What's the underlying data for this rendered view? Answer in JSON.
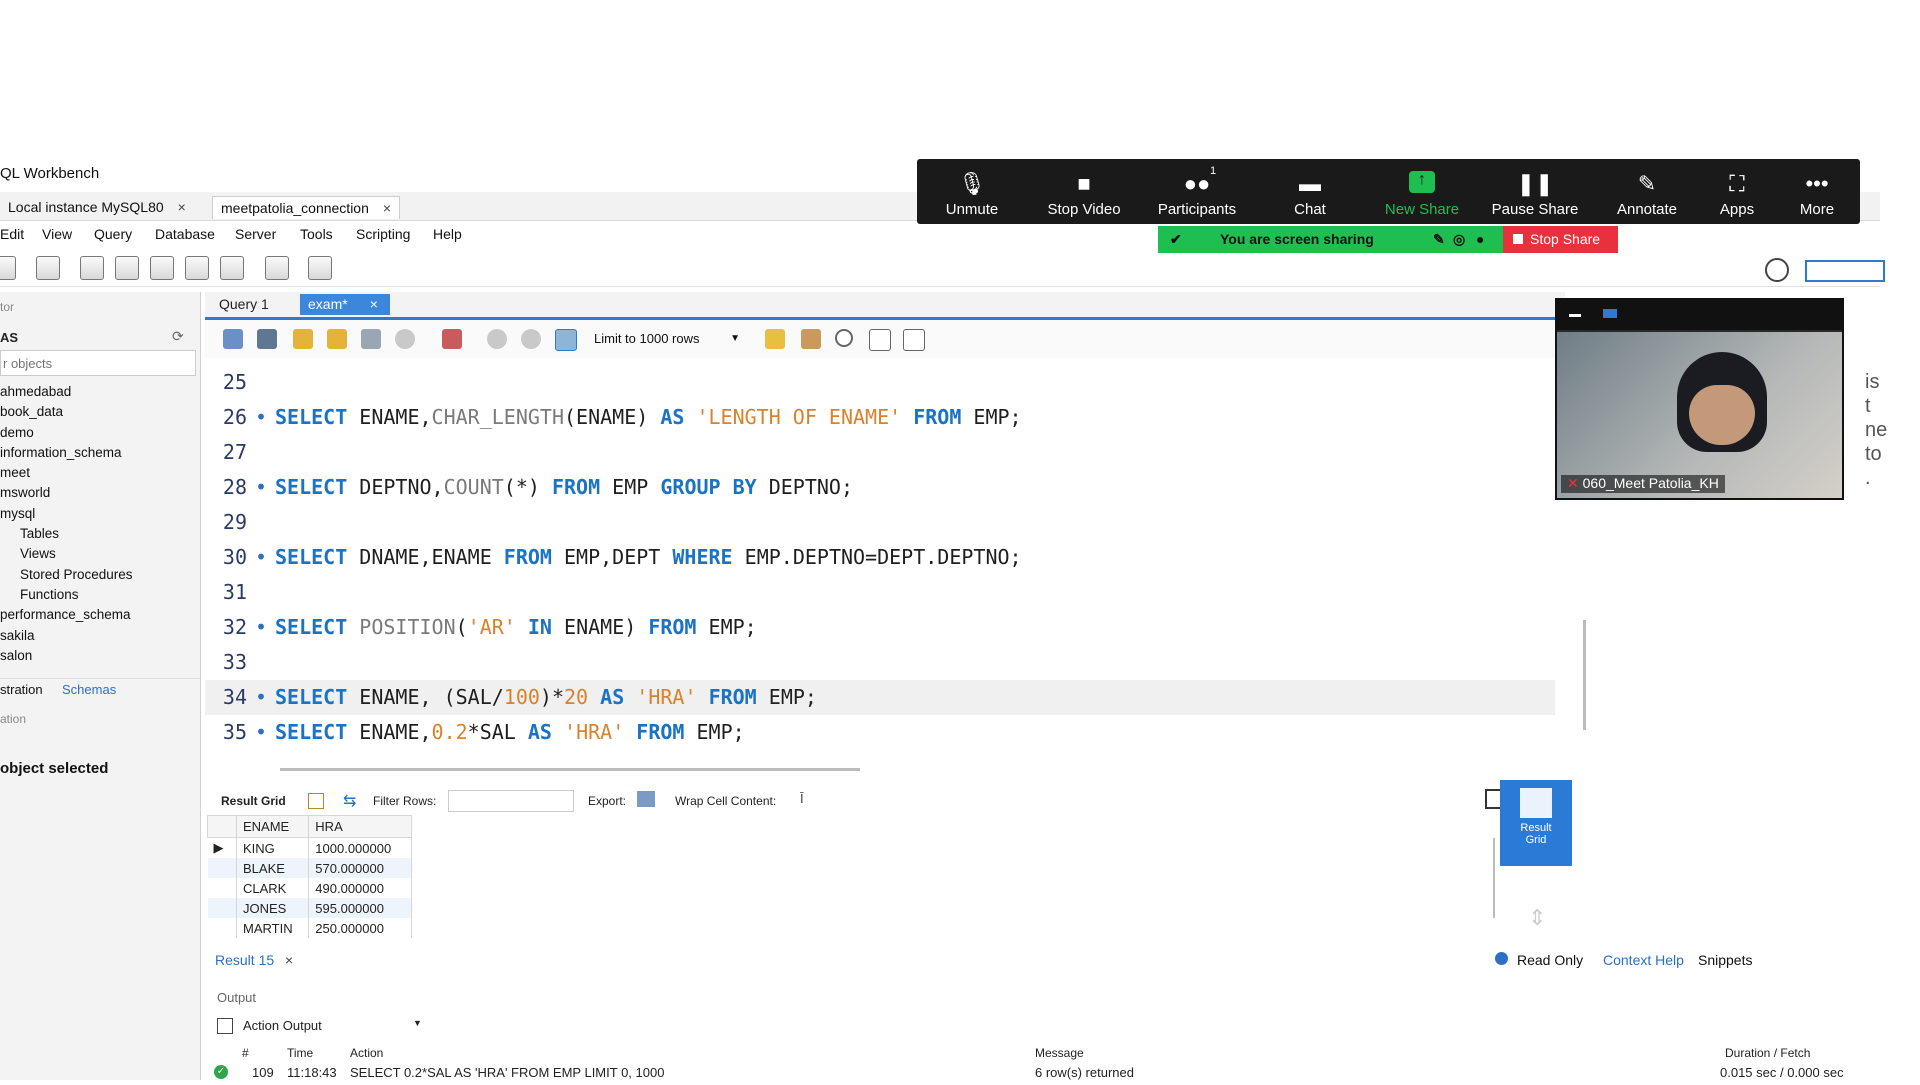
{
  "window": {
    "title": "QL Workbench"
  },
  "conn_tabs": [
    {
      "label": "Local instance MySQL80",
      "close": "×"
    },
    {
      "label": "meetpatolia_connection",
      "close": "×"
    }
  ],
  "menu": [
    "Edit",
    "View",
    "Query",
    "Database",
    "Server",
    "Tools",
    "Scripting",
    "Help"
  ],
  "navigator": {
    "title": "tor",
    "schemas_header": "AS",
    "filter_placeholder": "r objects",
    "schemas": [
      "ahmedabad",
      "book_data",
      "demo",
      "information_schema",
      "meet",
      "msworld",
      "mysql"
    ],
    "mysql_children": [
      "Tables",
      "Views",
      "Stored Procedures",
      "Functions"
    ],
    "more_schemas": [
      "performance_schema",
      "sakila",
      "salon"
    ],
    "tab_admin": "stration",
    "tab_schemas": "Schemas",
    "info_title": "ation",
    "info_text": "object selected"
  },
  "editor_tabs": [
    {
      "label": "Query 1"
    },
    {
      "label": "exam*",
      "close": "×"
    }
  ],
  "editor_toolbar": {
    "limit_label": "Limit to 1000 rows"
  },
  "code_lines": [
    {
      "n": "25",
      "dot": "",
      "tokens": []
    },
    {
      "n": "26",
      "dot": "•",
      "tokens": [
        [
          "kw",
          "SELECT"
        ],
        [
          "code",
          " ENAME,"
        ],
        [
          "fn",
          "CHAR_LENGTH"
        ],
        [
          "code",
          "(ENAME) "
        ],
        [
          "kw",
          "AS"
        ],
        [
          "code",
          " "
        ],
        [
          "str",
          "'LENGTH OF ENAME'"
        ],
        [
          "code",
          " "
        ],
        [
          "kw",
          "FROM"
        ],
        [
          "code",
          " EMP;"
        ]
      ]
    },
    {
      "n": "27",
      "dot": "",
      "tokens": []
    },
    {
      "n": "28",
      "dot": "•",
      "tokens": [
        [
          "kw",
          "SELECT"
        ],
        [
          "code",
          " DEPTNO,"
        ],
        [
          "fn",
          "COUNT"
        ],
        [
          "code",
          "(*) "
        ],
        [
          "kw",
          "FROM"
        ],
        [
          "code",
          " EMP "
        ],
        [
          "kw",
          "GROUP BY"
        ],
        [
          "code",
          " DEPTNO;"
        ]
      ]
    },
    {
      "n": "29",
      "dot": "",
      "tokens": []
    },
    {
      "n": "30",
      "dot": "•",
      "tokens": [
        [
          "kw",
          "SELECT"
        ],
        [
          "code",
          " DNAME,ENAME "
        ],
        [
          "kw",
          "FROM"
        ],
        [
          "code",
          " EMP,DEPT "
        ],
        [
          "kw",
          "WHERE"
        ],
        [
          "code",
          " EMP.DEPTNO=DEPT.DEPTNO;"
        ]
      ]
    },
    {
      "n": "31",
      "dot": "",
      "tokens": []
    },
    {
      "n": "32",
      "dot": "•",
      "tokens": [
        [
          "kw",
          "SELECT"
        ],
        [
          "code",
          " "
        ],
        [
          "fn",
          "POSITION"
        ],
        [
          "code",
          "("
        ],
        [
          "str",
          "'AR'"
        ],
        [
          "code",
          " "
        ],
        [
          "kw",
          "IN"
        ],
        [
          "code",
          " ENAME) "
        ],
        [
          "kw",
          "FROM"
        ],
        [
          "code",
          " EMP;"
        ]
      ]
    },
    {
      "n": "33",
      "dot": "",
      "tokens": []
    },
    {
      "n": "34",
      "dot": "•",
      "hl": true,
      "tokens": [
        [
          "kw",
          "SELECT"
        ],
        [
          "code",
          " ENAME, (SAL/"
        ],
        [
          "num",
          "100"
        ],
        [
          "code",
          ")*"
        ],
        [
          "num",
          "20"
        ],
        [
          "code",
          " "
        ],
        [
          "kw",
          "AS"
        ],
        [
          "code",
          " "
        ],
        [
          "str",
          "'HRA'"
        ],
        [
          "code",
          " "
        ],
        [
          "kw",
          "FROM"
        ],
        [
          "code",
          " EMP;"
        ]
      ]
    },
    {
      "n": "35",
      "dot": "•",
      "tokens": [
        [
          "kw",
          "SELECT"
        ],
        [
          "code",
          " ENAME,"
        ],
        [
          "num",
          "0.2"
        ],
        [
          "code",
          "*SAL "
        ],
        [
          "kw",
          "AS"
        ],
        [
          "code",
          " "
        ],
        [
          "str",
          "'HRA'"
        ],
        [
          "code",
          " "
        ],
        [
          "kw",
          "FROM"
        ],
        [
          "code",
          " EMP;"
        ]
      ]
    }
  ],
  "result_toolbar": {
    "result_grid": "Result Grid",
    "filter_rows": "Filter Rows:",
    "export": "Export:",
    "wrap": "Wrap Cell Content:"
  },
  "result_grid": {
    "columns": [
      "ENAME",
      "HRA"
    ],
    "rows": [
      [
        "KING",
        "1000.000000"
      ],
      [
        "BLAKE",
        "570.000000"
      ],
      [
        "CLARK",
        "490.000000"
      ],
      [
        "JONES",
        "595.000000"
      ],
      [
        "MARTIN",
        "250.000000"
      ]
    ]
  },
  "result_side": {
    "btn_line1": "Result",
    "btn_line2": "Grid",
    "read_only": "Read Only"
  },
  "bottom_tabs": {
    "result": "Result 15",
    "context_help": "Context Help",
    "snippets": "Snippets"
  },
  "output": {
    "title": "Output",
    "mode": "Action Output",
    "headers": [
      "#",
      "Time",
      "Action",
      "Message",
      "Duration / Fetch"
    ],
    "row": {
      "num": "109",
      "time": "11:18:43",
      "action": "SELECT 0.2*SAL AS 'HRA' FROM EMP LIMIT 0, 1000",
      "message": "6 row(s) returned",
      "duration": "0.015 sec / 0.000 sec"
    }
  },
  "zoom": {
    "buttons": [
      {
        "label": "Unmute",
        "icon": "mic-off-icon"
      },
      {
        "label": "Stop Video",
        "icon": "video-icon"
      },
      {
        "label": "Participants",
        "icon": "participants-icon",
        "badge": "1"
      },
      {
        "label": "Chat",
        "icon": "chat-icon"
      },
      {
        "label": "New Share",
        "icon": "share-icon"
      },
      {
        "label": "Pause Share",
        "icon": "pause-icon"
      },
      {
        "label": "Annotate",
        "icon": "pencil-icon"
      },
      {
        "label": "Apps",
        "icon": "apps-icon"
      },
      {
        "label": "More",
        "icon": "more-icon"
      }
    ],
    "sharing_text": "You are screen sharing",
    "stop_share": "Stop Share",
    "participant_name": "060_Meet Patolia_KH",
    "accent_green": "#1fbe51",
    "accent_red": "#e8313d"
  },
  "side_partial_text": [
    "is",
    "t",
    "ne",
    "to",
    "."
  ]
}
